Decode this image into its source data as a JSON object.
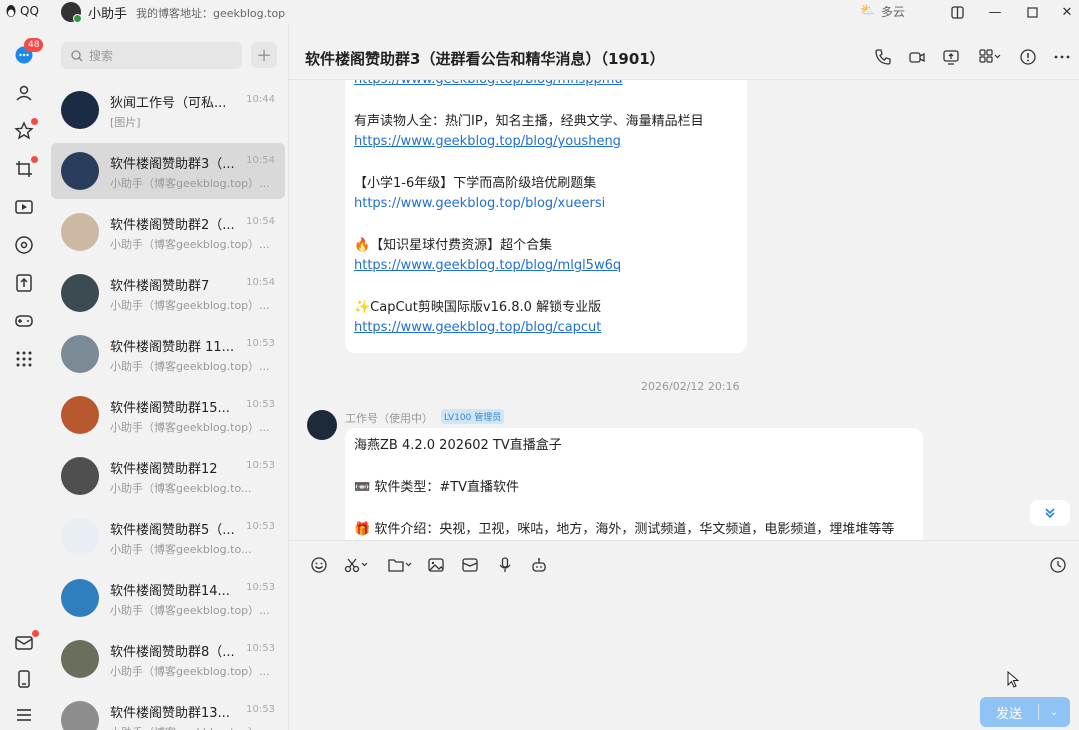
{
  "titlebar": {
    "brand": "QQ",
    "user_name": "小助手",
    "signature": "我的博客地址：geekblog.top",
    "weather": "多云"
  },
  "nav": {
    "badge_count": "48"
  },
  "search": {
    "placeholder": "搜索"
  },
  "conversations": [
    {
      "name": "狄闻工作号（可私...",
      "time": "10:44",
      "preview": "[图片]",
      "color": "#1c2b44"
    },
    {
      "name": "软件楼阁赞助群3（...",
      "time": "10:54",
      "preview": "小助手（博客geekblog.top）...",
      "color": "#2a3d5c"
    },
    {
      "name": "软件楼阁赞助群2（...",
      "time": "10:54",
      "preview": "小助手（博客geekblog.top）...",
      "color": "#cdb9a3"
    },
    {
      "name": "软件楼阁赞助群7",
      "time": "10:54",
      "preview": "小助手（博客geekblog.top）...",
      "color": "#3c4a52"
    },
    {
      "name": "软件楼阁赞助群 11...",
      "time": "10:53",
      "preview": "小助手（博客geekblog.top）...",
      "color": "#7a8a96"
    },
    {
      "name": "软件楼阁赞助群15...",
      "time": "10:53",
      "preview": "小助手（博客geekblog.top）...",
      "color": "#b8582e"
    },
    {
      "name": "软件楼阁赞助群12",
      "time": "10:53",
      "preview": "小助手（博客geekblog.to...",
      "color": "#4f4f4f"
    },
    {
      "name": "软件楼阁赞助群5（...",
      "time": "10:53",
      "preview": "小助手（博客geekblog.to...",
      "color": "#e9eef4"
    },
    {
      "name": "软件楼阁赞助群14...",
      "time": "10:53",
      "preview": "小助手（博客geekblog.top）...",
      "color": "#2f7fbf"
    },
    {
      "name": "软件楼阁赞助群8（...",
      "time": "10:53",
      "preview": "小助手（博客geekblog.top）...",
      "color": "#6a6e5c"
    },
    {
      "name": "软件楼阁赞助群13...",
      "time": "10:53",
      "preview": "小助手（博客geekblog.top）...",
      "color": "#8d8d8d"
    }
  ],
  "chat": {
    "title": "软件楼阁赞助群3（进群看公告和精华消息）（1901）",
    "msg1": {
      "link0": "https://www.geekblog.top/blog/mnsppmu",
      "t1": "有声读物人全：热门IP，知名主播，经典文学、海量精品栏目",
      "link1": "https://www.geekblog.top/blog/yousheng",
      "t2": "【小学1-6年级】下学而高阶级培优刷题集",
      "link2": "https://www.geekblog.top/blog/xueersi",
      "t3": "🔥【知识星球付费资源】超个合集",
      "link3": "https://www.geekblog.top/blog/mlgl5w6q",
      "t4": "✨CapCut剪映国际版v16.8.0 解锁专业版",
      "link4": "https://www.geekblog.top/blog/capcut"
    },
    "timestamp": "2026/02/12 20:16",
    "sender": "工作号（使用中）",
    "sender_tag": "LV100 管理员",
    "msg2": {
      "l1": "海燕ZB 4.2.0 202602 TV直播盒子",
      "l2": "📼 软件类型：#TV直播软件",
      "l3": "🎁 软件介绍：央视，卫视，咪咕，地方，海外，测试频道，华文频道，电影频道，埋堆堆等等"
    }
  },
  "composer": {
    "send_label": "发送"
  },
  "colors": {
    "accent": "#1f87e8",
    "send_bg": "#8fc3f5",
    "badge": "#f54a45"
  }
}
